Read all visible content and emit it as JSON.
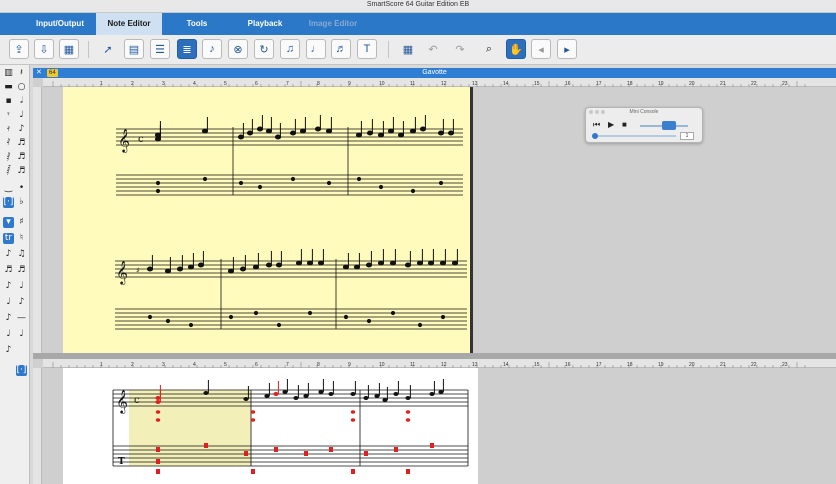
{
  "window": {
    "title": "SmartScore 64 Guitar Edition EB"
  },
  "tabs": [
    {
      "label": "Input/Output",
      "state": "normal"
    },
    {
      "label": "Note Editor",
      "state": "active"
    },
    {
      "label": "Tools",
      "state": "normal"
    },
    {
      "label": "Playback",
      "state": "normal"
    },
    {
      "label": "Image Editor",
      "state": "disabled"
    }
  ],
  "toolbar": {
    "icons": [
      "import-icon",
      "export-icon",
      "page-view-icon",
      "pointer-icon",
      "page-insert-icon",
      "mixer-icon",
      "layout-icon",
      "voice-icon",
      "delete-note-icon",
      "reverse-play-icon",
      "repeat-icon",
      "note-icon",
      "split-icon",
      "text-icon",
      "calculator-icon",
      "undo-icon",
      "redo-icon",
      "zoom-icon",
      "hand-tool-icon",
      "prev-page-icon",
      "next-page-icon"
    ]
  },
  "score_window": {
    "title": "Gavotte",
    "close_symbol": "✕",
    "doc_badge": "64",
    "ruler_numbers": [
      "1",
      "2",
      "3",
      "4",
      "5",
      "6",
      "7",
      "8",
      "9",
      "10",
      "11",
      "12",
      "13",
      "14",
      "15",
      "16",
      "17",
      "18",
      "19",
      "20",
      "21",
      "22",
      "23"
    ]
  },
  "mini_console": {
    "title": "Mini Console",
    "rewind_symbol": "⏮",
    "play_symbol": "▶",
    "stop_symbol": "■",
    "measure_value": "1"
  },
  "colors": {
    "tab_bar": "#2b78c9",
    "active_tab": "#cfe0f2",
    "scan_page": "#fffbbd",
    "edit_notes": "#e02020",
    "accent": "#2f79cd"
  }
}
